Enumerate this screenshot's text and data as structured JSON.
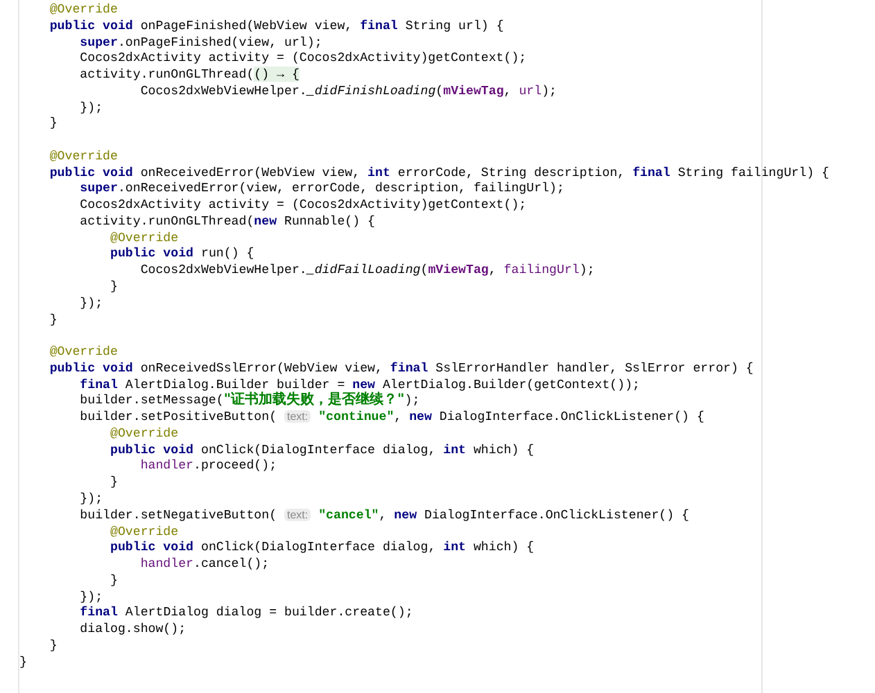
{
  "editor": {
    "blocks": [
      {
        "lines": [
          [
            {
              "kind": "annotation",
              "text": "    @Override"
            }
          ],
          [
            {
              "kind": "keyword",
              "text": "    public void "
            },
            {
              "kind": "plain",
              "text": "onPageFinished(WebView view, "
            },
            {
              "kind": "keyword",
              "text": "final "
            },
            {
              "kind": "plain",
              "text": "String url) {"
            }
          ],
          [
            {
              "kind": "keyword",
              "text": "        super"
            },
            {
              "kind": "plain",
              "text": ".onPageFinished(view, url);"
            }
          ],
          [
            {
              "kind": "plain",
              "text": "        Cocos2dxActivity activity = (Cocos2dxActivity)getContext();"
            }
          ],
          [
            {
              "kind": "plain",
              "text": "        activity.runOnGLThread("
            },
            {
              "kind": "lambda",
              "text": "() → {"
            }
          ],
          [
            {
              "kind": "plain",
              "text": "                Cocos2dxWebViewHelper."
            },
            {
              "kind": "static",
              "text": "_didFinishLoading"
            },
            {
              "kind": "plain",
              "text": "("
            },
            {
              "kind": "field",
              "text": "mViewTag"
            },
            {
              "kind": "plain",
              "text": ", "
            },
            {
              "kind": "captured",
              "text": "url"
            },
            {
              "kind": "plain",
              "text": ");"
            }
          ],
          [
            {
              "kind": "plain",
              "text": "        });"
            }
          ],
          [
            {
              "kind": "plain",
              "text": "    }"
            }
          ]
        ]
      },
      {
        "lines": [
          [
            {
              "kind": "annotation",
              "text": "    @Override"
            }
          ],
          [
            {
              "kind": "keyword",
              "text": "    public void "
            },
            {
              "kind": "plain",
              "text": "onReceivedError(WebView view, "
            },
            {
              "kind": "keyword",
              "text": "int "
            },
            {
              "kind": "plain",
              "text": "errorCode, String description, "
            },
            {
              "kind": "keyword",
              "text": "final "
            },
            {
              "kind": "plain",
              "text": "String failingUrl) {"
            }
          ],
          [
            {
              "kind": "keyword",
              "text": "        super"
            },
            {
              "kind": "plain",
              "text": ".onReceivedError(view, errorCode, description, failingUrl);"
            }
          ],
          [
            {
              "kind": "plain",
              "text": "        Cocos2dxActivity activity = (Cocos2dxActivity)getContext();"
            }
          ],
          [
            {
              "kind": "plain",
              "text": "        activity.runOnGLThread("
            },
            {
              "kind": "keyword",
              "text": "new "
            },
            {
              "kind": "plain",
              "text": "Runnable() {"
            }
          ],
          [
            {
              "kind": "annotation",
              "text": "            @Override"
            }
          ],
          [
            {
              "kind": "keyword",
              "text": "            public void "
            },
            {
              "kind": "plain",
              "text": "run() {"
            }
          ],
          [
            {
              "kind": "plain",
              "text": "                Cocos2dxWebViewHelper."
            },
            {
              "kind": "static",
              "text": "_didFailLoading"
            },
            {
              "kind": "plain",
              "text": "("
            },
            {
              "kind": "field",
              "text": "mViewTag"
            },
            {
              "kind": "plain",
              "text": ", "
            },
            {
              "kind": "captured",
              "text": "failingUrl"
            },
            {
              "kind": "plain",
              "text": ");"
            }
          ],
          [
            {
              "kind": "plain",
              "text": "            }"
            }
          ],
          [
            {
              "kind": "plain",
              "text": "        });"
            }
          ],
          [
            {
              "kind": "plain",
              "text": "    }"
            }
          ]
        ]
      },
      {
        "lines": [
          [
            {
              "kind": "annotation",
              "text": "    @Override"
            }
          ],
          [
            {
              "kind": "keyword",
              "text": "    public void "
            },
            {
              "kind": "plain",
              "text": "onReceivedSslError(WebView view, "
            },
            {
              "kind": "keyword",
              "text": "final "
            },
            {
              "kind": "plain",
              "text": "SslErrorHandler handler, SslError error) {"
            }
          ],
          [
            {
              "kind": "keyword",
              "text": "        final "
            },
            {
              "kind": "plain",
              "text": "AlertDialog.Builder builder = "
            },
            {
              "kind": "keyword",
              "text": "new "
            },
            {
              "kind": "plain",
              "text": "AlertDialog.Builder(getContext());"
            }
          ],
          [
            {
              "kind": "plain",
              "text": "        builder.setMessage("
            },
            {
              "kind": "string",
              "text": "\"证书加载失败，是否继续？\""
            },
            {
              "kind": "plain",
              "text": ");"
            }
          ],
          [
            {
              "kind": "plain",
              "text": "        builder.setPositiveButton( "
            },
            {
              "kind": "hint",
              "text": "text:"
            },
            {
              "kind": "string",
              "text": " \"continue\""
            },
            {
              "kind": "plain",
              "text": ", "
            },
            {
              "kind": "keyword",
              "text": "new "
            },
            {
              "kind": "plain",
              "text": "DialogInterface.OnClickListener() {"
            }
          ],
          [
            {
              "kind": "annotation",
              "text": "            @Override"
            }
          ],
          [
            {
              "kind": "keyword",
              "text": "            public void "
            },
            {
              "kind": "plain",
              "text": "onClick(DialogInterface dialog, "
            },
            {
              "kind": "keyword",
              "text": "int "
            },
            {
              "kind": "plain",
              "text": "which) {"
            }
          ],
          [
            {
              "kind": "captured",
              "text": "                handler"
            },
            {
              "kind": "plain",
              "text": ".proceed();"
            }
          ],
          [
            {
              "kind": "plain",
              "text": "            }"
            }
          ],
          [
            {
              "kind": "plain",
              "text": "        });"
            }
          ],
          [
            {
              "kind": "plain",
              "text": "        builder.setNegativeButton( "
            },
            {
              "kind": "hint",
              "text": "text:"
            },
            {
              "kind": "string",
              "text": " \"cancel\""
            },
            {
              "kind": "plain",
              "text": ", "
            },
            {
              "kind": "keyword",
              "text": "new "
            },
            {
              "kind": "plain",
              "text": "DialogInterface.OnClickListener() {"
            }
          ],
          [
            {
              "kind": "annotation",
              "text": "            @Override"
            }
          ],
          [
            {
              "kind": "keyword",
              "text": "            public void "
            },
            {
              "kind": "plain",
              "text": "onClick(DialogInterface dialog, "
            },
            {
              "kind": "keyword",
              "text": "int "
            },
            {
              "kind": "plain",
              "text": "which) {"
            }
          ],
          [
            {
              "kind": "captured",
              "text": "                handler"
            },
            {
              "kind": "plain",
              "text": ".cancel();"
            }
          ],
          [
            {
              "kind": "plain",
              "text": "            }"
            }
          ],
          [
            {
              "kind": "plain",
              "text": "        });"
            }
          ],
          [
            {
              "kind": "keyword",
              "text": "        final "
            },
            {
              "kind": "plain",
              "text": "AlertDialog dialog = builder.create();"
            }
          ],
          [
            {
              "kind": "plain",
              "text": "        dialog.show();"
            }
          ],
          [
            {
              "kind": "plain",
              "text": "    }"
            }
          ],
          [
            {
              "kind": "plain",
              "text": "}"
            }
          ]
        ]
      }
    ]
  }
}
